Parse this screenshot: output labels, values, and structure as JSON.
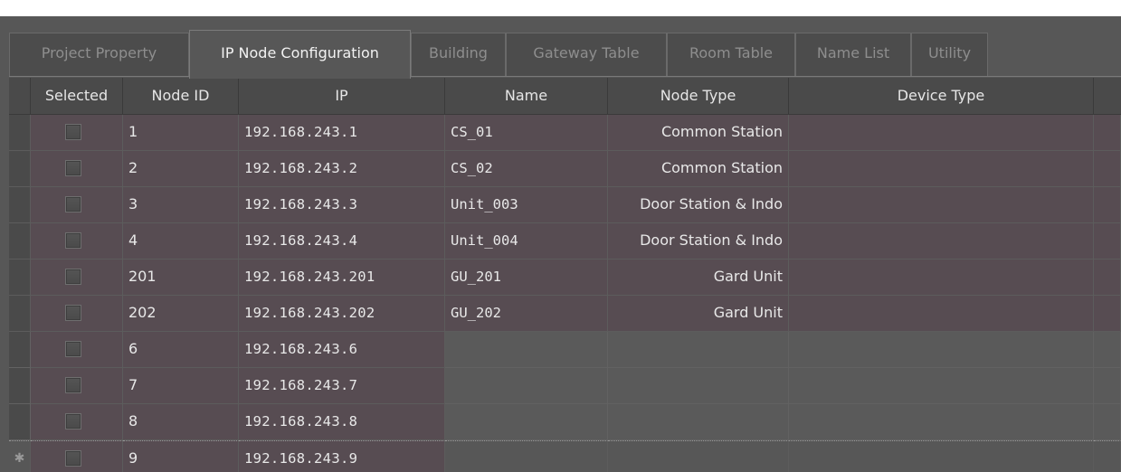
{
  "tabs": [
    {
      "label": "Project Property",
      "active": false
    },
    {
      "label": "IP Node Configuration",
      "active": true
    },
    {
      "label": "Building",
      "active": false
    },
    {
      "label": "Gateway Table",
      "active": false
    },
    {
      "label": "Room Table",
      "active": false
    },
    {
      "label": "Name List",
      "active": false
    },
    {
      "label": "Utility",
      "active": false
    }
  ],
  "table": {
    "columns": [
      "Selected",
      "Node ID",
      "IP",
      "Name",
      "Node Type",
      "Device Type"
    ],
    "rows": [
      {
        "selected": false,
        "node_id": "1",
        "ip": "192.168.243.1",
        "name": "CS_01",
        "node_type": "Common Station",
        "device_type": ""
      },
      {
        "selected": false,
        "node_id": "2",
        "ip": "192.168.243.2",
        "name": "CS_02",
        "node_type": "Common Station",
        "device_type": ""
      },
      {
        "selected": false,
        "node_id": "3",
        "ip": "192.168.243.3",
        "name": "Unit_003",
        "node_type": "Door Station & Indo",
        "device_type": ""
      },
      {
        "selected": false,
        "node_id": "4",
        "ip": "192.168.243.4",
        "name": "Unit_004",
        "node_type": "Door Station & Indo",
        "device_type": ""
      },
      {
        "selected": false,
        "node_id": "201",
        "ip": "192.168.243.201",
        "name": "GU_201",
        "node_type": "Gard Unit",
        "device_type": ""
      },
      {
        "selected": false,
        "node_id": "202",
        "ip": "192.168.243.202",
        "name": "GU_202",
        "node_type": "Gard Unit",
        "device_type": ""
      },
      {
        "selected": false,
        "node_id": "6",
        "ip": "192.168.243.6",
        "name": "",
        "node_type": "",
        "device_type": ""
      },
      {
        "selected": false,
        "node_id": "7",
        "ip": "192.168.243.7",
        "name": "",
        "node_type": "",
        "device_type": ""
      },
      {
        "selected": false,
        "node_id": "8",
        "ip": "192.168.243.8",
        "name": "",
        "node_type": "",
        "device_type": ""
      },
      {
        "selected": false,
        "node_id": "9",
        "ip": "192.168.243.9",
        "name": "",
        "node_type": "",
        "device_type": "",
        "new_row": true,
        "row_marker": "✱"
      }
    ]
  },
  "colors": {
    "background": "#575757",
    "row_fill": "#574c52",
    "header_fill": "#4a4a4a",
    "active_tab_text": "#f2f2f2",
    "inactive_tab_text": "#8e8e8e"
  }
}
